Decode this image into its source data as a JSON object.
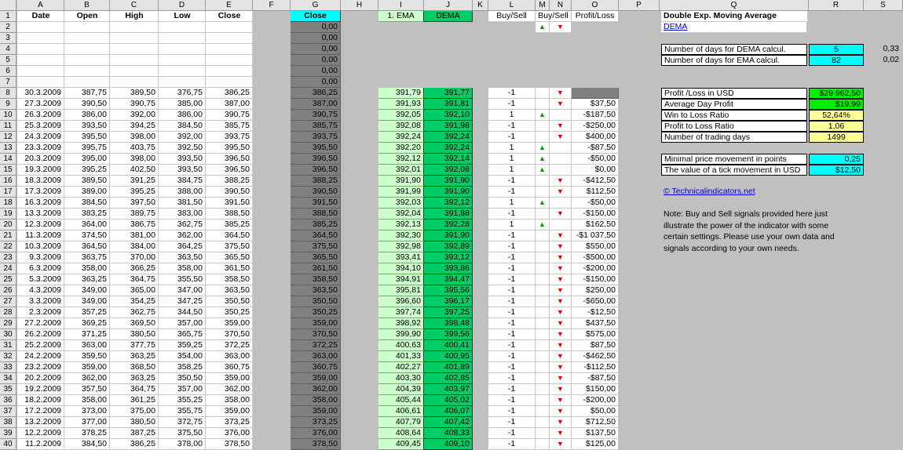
{
  "columns": [
    "A",
    "B",
    "C",
    "D",
    "E",
    "F",
    "G",
    "H",
    "I",
    "J",
    "K",
    "L",
    "M",
    "N",
    "O",
    "P",
    "Q",
    "R",
    "S"
  ],
  "headers": {
    "date": "Date",
    "open": "Open",
    "high": "High",
    "low": "Low",
    "close": "Close",
    "g_close": "Close",
    "ema": "1. EMA",
    "dema": "DEMA",
    "buy_sell_l": "Buy/Sell",
    "buy_sell_mn": "Buy/Sell",
    "profit_loss": "Profit/Loss"
  },
  "g_zeros": [
    "0,00",
    "0,00",
    "0,00",
    "0,00",
    "0,00",
    "0,00"
  ],
  "rows": [
    {
      "n": 8,
      "date": "30.3.2009",
      "open": "387,75",
      "high": "389,50",
      "low": "376,75",
      "close": "386,25",
      "g": "386,25",
      "ema": "391,79",
      "dema": "391,77",
      "sig": "-1",
      "arrow": "down",
      "pl": ""
    },
    {
      "n": 9,
      "date": "27.3.2009",
      "open": "390,50",
      "high": "390,75",
      "low": "385,00",
      "close": "387,00",
      "g": "387,00",
      "ema": "391,93",
      "dema": "391,81",
      "sig": "-1",
      "arrow": "down",
      "pl": "$37,50"
    },
    {
      "n": 10,
      "date": "26.3.2009",
      "open": "386,00",
      "high": "392,00",
      "low": "386,00",
      "close": "390,75",
      "g": "390,75",
      "ema": "392,05",
      "dema": "392,10",
      "sig": "1",
      "arrow": "up",
      "pl": "-$187,50"
    },
    {
      "n": 11,
      "date": "25.3.2009",
      "open": "393,50",
      "high": "394,25",
      "low": "384,50",
      "close": "385,75",
      "g": "385,75",
      "ema": "392,08",
      "dema": "391,98",
      "sig": "-1",
      "arrow": "down",
      "pl": "-$250,00"
    },
    {
      "n": 12,
      "date": "24.3.2009",
      "open": "395,50",
      "high": "398,00",
      "low": "392,00",
      "close": "393,75",
      "g": "393,75",
      "ema": "392,24",
      "dema": "392,24",
      "sig": "-1",
      "arrow": "down",
      "pl": "$400,00"
    },
    {
      "n": 13,
      "date": "23.3.2009",
      "open": "395,75",
      "high": "403,75",
      "low": "392,50",
      "close": "395,50",
      "g": "395,50",
      "ema": "392,20",
      "dema": "392,24",
      "sig": "1",
      "arrow": "up",
      "pl": "-$87,50"
    },
    {
      "n": 14,
      "date": "20.3.2009",
      "open": "395,00",
      "high": "398,00",
      "low": "393,50",
      "close": "396,50",
      "g": "396,50",
      "ema": "392,12",
      "dema": "392,14",
      "sig": "1",
      "arrow": "up",
      "pl": "-$50,00"
    },
    {
      "n": 15,
      "date": "19.3.2009",
      "open": "395,25",
      "high": "402,50",
      "low": "393,50",
      "close": "396,50",
      "g": "396,50",
      "ema": "392,01",
      "dema": "392,08",
      "sig": "1",
      "arrow": "up",
      "pl": "$0,00"
    },
    {
      "n": 16,
      "date": "18.3.2009",
      "open": "389,50",
      "high": "391,25",
      "low": "384,75",
      "close": "388,25",
      "g": "388,25",
      "ema": "391,90",
      "dema": "391,90",
      "sig": "-1",
      "arrow": "down",
      "pl": "-$412,50"
    },
    {
      "n": 17,
      "date": "17.3.2009",
      "open": "389,00",
      "high": "395,25",
      "low": "388,00",
      "close": "390,50",
      "g": "390,50",
      "ema": "391,99",
      "dema": "391,90",
      "sig": "-1",
      "arrow": "down",
      "pl": "$112,50"
    },
    {
      "n": 18,
      "date": "16.3.2009",
      "open": "384,50",
      "high": "397,50",
      "low": "381,50",
      "close": "391,50",
      "g": "391,50",
      "ema": "392,03",
      "dema": "392,12",
      "sig": "1",
      "arrow": "up",
      "pl": "-$50,00"
    },
    {
      "n": 19,
      "date": "13.3.2009",
      "open": "383,25",
      "high": "389,75",
      "low": "383,00",
      "close": "388,50",
      "g": "388,50",
      "ema": "392,04",
      "dema": "391,88",
      "sig": "-1",
      "arrow": "down",
      "pl": "-$150,00"
    },
    {
      "n": 20,
      "date": "12.3.2009",
      "open": "364,00",
      "high": "386,75",
      "low": "362,75",
      "close": "385,25",
      "g": "385,25",
      "ema": "392,13",
      "dema": "392,28",
      "sig": "1",
      "arrow": "up",
      "pl": "$162,50"
    },
    {
      "n": 21,
      "date": "11.3.2009",
      "open": "374,50",
      "high": "381,00",
      "low": "362,00",
      "close": "364,50",
      "g": "364,50",
      "ema": "392,30",
      "dema": "391,90",
      "sig": "-1",
      "arrow": "down",
      "pl": "-$1 037,50"
    },
    {
      "n": 22,
      "date": "10.3.2009",
      "open": "364,50",
      "high": "384,00",
      "low": "364,25",
      "close": "375,50",
      "g": "375,50",
      "ema": "392,98",
      "dema": "392,89",
      "sig": "-1",
      "arrow": "down",
      "pl": "$550,00"
    },
    {
      "n": 23,
      "date": "9.3.2009",
      "open": "363,75",
      "high": "370,00",
      "low": "363,50",
      "close": "365,50",
      "g": "365,50",
      "ema": "393,41",
      "dema": "393,12",
      "sig": "-1",
      "arrow": "down",
      "pl": "-$500,00"
    },
    {
      "n": 24,
      "date": "6.3.2009",
      "open": "358,00",
      "high": "366,25",
      "low": "358,00",
      "close": "361,50",
      "g": "361,50",
      "ema": "394,10",
      "dema": "393,86",
      "sig": "-1",
      "arrow": "down",
      "pl": "-$200,00"
    },
    {
      "n": 25,
      "date": "5.3.2009",
      "open": "363,25",
      "high": "364,75",
      "low": "355,50",
      "close": "358,50",
      "g": "358,50",
      "ema": "394,91",
      "dema": "394,47",
      "sig": "-1",
      "arrow": "down",
      "pl": "-$150,00"
    },
    {
      "n": 26,
      "date": "4.3.2009",
      "open": "349,00",
      "high": "365,00",
      "low": "347,00",
      "close": "363,50",
      "g": "363,50",
      "ema": "395,81",
      "dema": "395,56",
      "sig": "-1",
      "arrow": "down",
      "pl": "$250,00"
    },
    {
      "n": 27,
      "date": "3.3.2009",
      "open": "349,00",
      "high": "354,25",
      "low": "347,25",
      "close": "350,50",
      "g": "350,50",
      "ema": "396,60",
      "dema": "396,17",
      "sig": "-1",
      "arrow": "down",
      "pl": "-$650,00"
    },
    {
      "n": 28,
      "date": "2.3.2009",
      "open": "357,25",
      "high": "362,75",
      "low": "344,50",
      "close": "350,25",
      "g": "350,25",
      "ema": "397,74",
      "dema": "397,25",
      "sig": "-1",
      "arrow": "down",
      "pl": "-$12,50"
    },
    {
      "n": 29,
      "date": "27.2.2009",
      "open": "369,25",
      "high": "369,50",
      "low": "357,00",
      "close": "359,00",
      "g": "359,00",
      "ema": "398,92",
      "dema": "398,48",
      "sig": "-1",
      "arrow": "down",
      "pl": "$437,50"
    },
    {
      "n": 30,
      "date": "26.2.2009",
      "open": "371,25",
      "high": "380,50",
      "low": "365,75",
      "close": "370,50",
      "g": "370,50",
      "ema": "399,90",
      "dema": "399,56",
      "sig": "-1",
      "arrow": "down",
      "pl": "$575,00"
    },
    {
      "n": 31,
      "date": "25.2.2009",
      "open": "363,00",
      "high": "377,75",
      "low": "359,25",
      "close": "372,25",
      "g": "372,25",
      "ema": "400,63",
      "dema": "400,41",
      "sig": "-1",
      "arrow": "down",
      "pl": "$87,50"
    },
    {
      "n": 32,
      "date": "24.2.2009",
      "open": "359,50",
      "high": "363,25",
      "low": "354,00",
      "close": "363,00",
      "g": "363,00",
      "ema": "401,33",
      "dema": "400,95",
      "sig": "-1",
      "arrow": "down",
      "pl": "-$462,50"
    },
    {
      "n": 33,
      "date": "23.2.2009",
      "open": "359,00",
      "high": "368,50",
      "low": "358,25",
      "close": "360,75",
      "g": "360,75",
      "ema": "402,27",
      "dema": "401,89",
      "sig": "-1",
      "arrow": "down",
      "pl": "-$112,50"
    },
    {
      "n": 34,
      "date": "20.2.2009",
      "open": "362,00",
      "high": "363,25",
      "low": "350,50",
      "close": "359,00",
      "g": "359,00",
      "ema": "403,30",
      "dema": "402,85",
      "sig": "-1",
      "arrow": "down",
      "pl": "-$87,50"
    },
    {
      "n": 35,
      "date": "19.2.2009",
      "open": "357,50",
      "high": "364,75",
      "low": "357,00",
      "close": "362,00",
      "g": "362,00",
      "ema": "404,39",
      "dema": "403,97",
      "sig": "-1",
      "arrow": "down",
      "pl": "$150,00"
    },
    {
      "n": 36,
      "date": "18.2.2009",
      "open": "358,00",
      "high": "361,25",
      "low": "355,25",
      "close": "358,00",
      "g": "358,00",
      "ema": "405,44",
      "dema": "405,02",
      "sig": "-1",
      "arrow": "down",
      "pl": "-$200,00"
    },
    {
      "n": 37,
      "date": "17.2.2009",
      "open": "373,00",
      "high": "375,00",
      "low": "355,75",
      "close": "359,00",
      "g": "359,00",
      "ema": "406,61",
      "dema": "406,07",
      "sig": "-1",
      "arrow": "down",
      "pl": "$50,00"
    },
    {
      "n": 38,
      "date": "13.2.2009",
      "open": "377,00",
      "high": "380,50",
      "low": "372,75",
      "close": "373,25",
      "g": "373,25",
      "ema": "407,79",
      "dema": "407,42",
      "sig": "-1",
      "arrow": "down",
      "pl": "$712,50"
    },
    {
      "n": 39,
      "date": "12.2.2009",
      "open": "378,25",
      "high": "387,25",
      "low": "375,50",
      "close": "376,00",
      "g": "376,00",
      "ema": "408,64",
      "dema": "408,33",
      "sig": "-1",
      "arrow": "down",
      "pl": "$137,50"
    },
    {
      "n": 40,
      "date": "11.2.2009",
      "open": "384,50",
      "high": "386,25",
      "low": "378,00",
      "close": "378,50",
      "g": "378,50",
      "ema": "409,45",
      "dema": "409,10",
      "sig": "-1",
      "arrow": "down",
      "pl": "$125,00"
    }
  ],
  "panel": {
    "title": "Double Exp. Moving Average",
    "link": "DEMA",
    "days_dema_label": "Number of days for DEMA calcul.",
    "days_dema": "5",
    "days_dema_s": "0,33",
    "days_ema_label": "Number of days for EMA calcul.",
    "days_ema": "82",
    "days_ema_s": "0,02",
    "profit_label": "Profit /Loss in USD",
    "profit": "$29 962,50",
    "avg_label": "Average Day Profit",
    "avg": "$19,99",
    "win_label": "Win to Loss Ratio",
    "win": "52,64%",
    "ptl_label": "Profit to Loss Ratio",
    "ptl": "1,06",
    "days_label": "Number of trading days",
    "days": "1499",
    "minmove_label": "Minimal price movement in points",
    "minmove": "0,25",
    "tick_label": "The value of a tick movement in USD",
    "tick": "$12,50",
    "site": "© Technicalindicators.net",
    "note": "Note: Buy and Sell signals provided here just illustrate the power of the indicator with some certain settings. Please use your own data and signals according to your own needs."
  },
  "colors": {
    "up": "#00a000",
    "down": "#e00000",
    "dema_green": "#00cc66",
    "close_cyan": "#00ffff",
    "profit_green": "#00ee00",
    "ratio_yellow": "#ffff99"
  }
}
